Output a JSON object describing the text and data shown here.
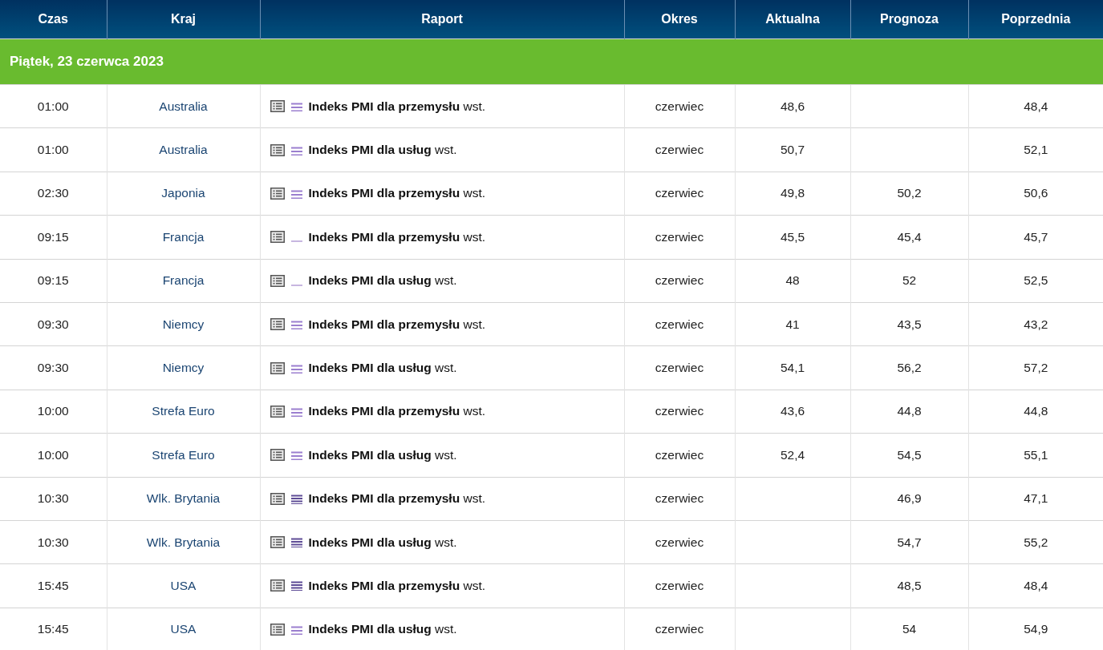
{
  "table": {
    "columns": [
      "Czas",
      "Kraj",
      "Raport",
      "Okres",
      "Aktualna",
      "Prognoza",
      "Poprzednia"
    ],
    "date_header": "Piątek, 23 czerwca 2023",
    "rows": [
      {
        "time": "01:00",
        "country": "Australia",
        "kind": "medium",
        "report": "**Indeks PMI dla przemysłu** wst.",
        "period": "czerwiec",
        "actual": "48,6",
        "forecast": "",
        "previous": "48,4"
      },
      {
        "time": "01:00",
        "country": "Australia",
        "kind": "medium",
        "report": "**Indeks PMI dla usług** wst.",
        "period": "czerwiec",
        "actual": "50,7",
        "forecast": "",
        "previous": "52,1"
      },
      {
        "time": "02:30",
        "country": "Japonia",
        "kind": "medium",
        "report": "**Indeks PMI dla przemysłu** wst.",
        "period": "czerwiec",
        "actual": "49,8",
        "forecast": "50,2",
        "previous": "50,6"
      },
      {
        "time": "09:15",
        "country": "Francja",
        "kind": "low",
        "report": "**Indeks PMI dla przemysłu** wst.",
        "period": "czerwiec",
        "actual": "45,5",
        "forecast": "45,4",
        "previous": "45,7"
      },
      {
        "time": "09:15",
        "country": "Francja",
        "kind": "low",
        "report": "**Indeks PMI dla usług** wst.",
        "period": "czerwiec",
        "actual": "48",
        "forecast": "52",
        "previous": "52,5"
      },
      {
        "time": "09:30",
        "country": "Niemcy",
        "kind": "medium",
        "report": "**Indeks PMI dla przemysłu** wst.",
        "period": "czerwiec",
        "actual": "41",
        "forecast": "43,5",
        "previous": "43,2"
      },
      {
        "time": "09:30",
        "country": "Niemcy",
        "kind": "medium",
        "report": "**Indeks PMI dla usług** wst.",
        "period": "czerwiec",
        "actual": "54,1",
        "forecast": "56,2",
        "previous": "57,2"
      },
      {
        "time": "10:00",
        "country": "Strefa Euro",
        "kind": "medium",
        "report": "**Indeks PMI dla przemysłu** wst.",
        "period": "czerwiec",
        "actual": "43,6",
        "forecast": "44,8",
        "previous": "44,8"
      },
      {
        "time": "10:00",
        "country": "Strefa Euro",
        "kind": "medium",
        "report": "**Indeks PMI dla usług** wst.",
        "period": "czerwiec",
        "actual": "52,4",
        "forecast": "54,5",
        "previous": "55,1"
      },
      {
        "time": "10:30",
        "country": "Wlk. Brytania",
        "kind": "high",
        "report": "**Indeks PMI dla przemysłu** wst.",
        "period": "czerwiec",
        "actual": "",
        "forecast": "46,9",
        "previous": "47,1"
      },
      {
        "time": "10:30",
        "country": "Wlk. Brytania",
        "kind": "high",
        "report": "**Indeks PMI dla usług** wst.",
        "period": "czerwiec",
        "actual": "",
        "forecast": "54,7",
        "previous": "55,2"
      },
      {
        "time": "15:45",
        "country": "USA",
        "kind": "high",
        "report": "**Indeks PMI dla przemysłu** wst.",
        "period": "czerwiec",
        "actual": "",
        "forecast": "48,5",
        "previous": "48,4"
      },
      {
        "time": "15:45",
        "country": "USA",
        "kind": "medium",
        "report": "**Indeks PMI dla usług** wst.",
        "period": "czerwiec",
        "actual": "",
        "forecast": "54",
        "previous": "54,9"
      }
    ]
  }
}
